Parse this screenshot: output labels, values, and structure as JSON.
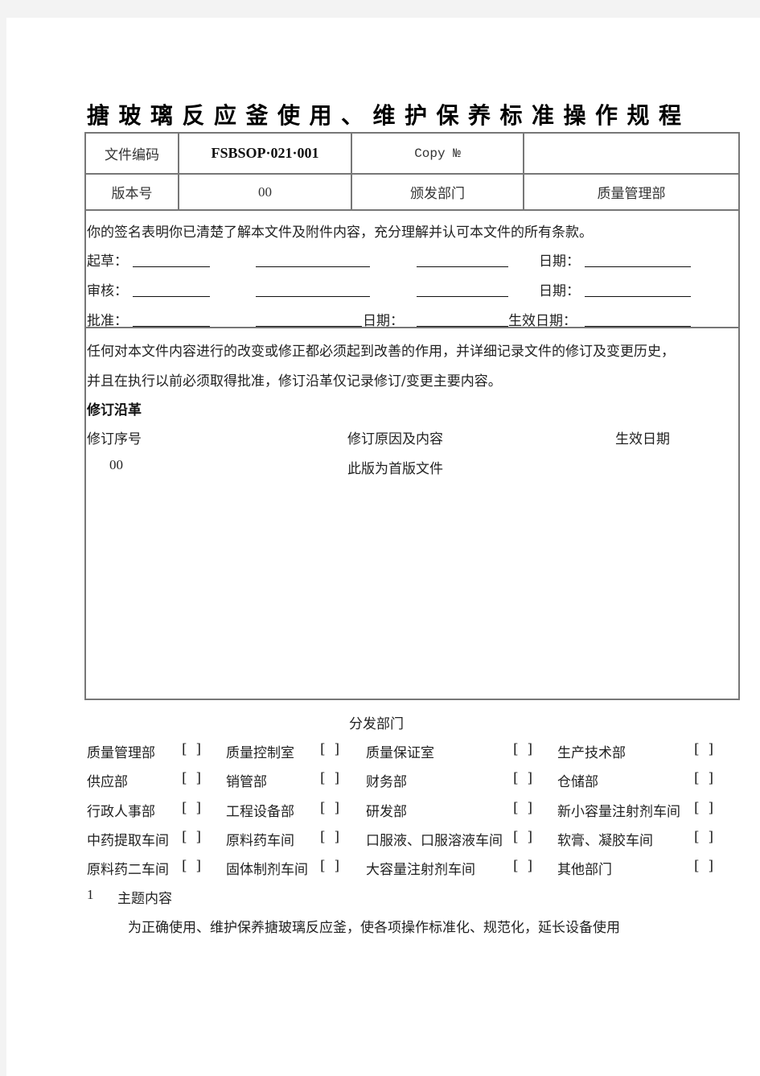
{
  "document": {
    "title": "搪玻璃反应釜使用、维护保养标准操作规程",
    "header_table": {
      "row1": {
        "label1": "文件编码",
        "value1": "FSBSOP·021·001",
        "label2": "Copy №",
        "value2": ""
      },
      "row2": {
        "label1": "版本号",
        "value1": "00",
        "label2": "颁发部门",
        "value2": "质量管理部"
      }
    },
    "signature_section": {
      "statement": "你的签名表明你已清楚了解本文件及附件内容，充分理解并认可本文件的所有条款。",
      "rows": [
        {
          "label": "起草：",
          "date_label": "日期："
        },
        {
          "label": "审核：",
          "date_label": "日期："
        },
        {
          "label": "批准：",
          "mid_label": "日期：",
          "date_label": "生效日期："
        }
      ]
    },
    "revision_section": {
      "statement_line1": "任何对本文件内容进行的改变或修正都必须起到改善的作用，并详细记录文件的修订及变更历史，",
      "statement_line2": "并且在执行以前必须取得批准，修订沿革仅记录修订/变更主要内容。",
      "heading": "修订沿革",
      "columns": [
        "修订序号",
        "修订原因及内容",
        "生效日期"
      ],
      "rows": [
        {
          "number": "00",
          "reason": "此版为首版文件",
          "date": ""
        }
      ]
    },
    "distribution": {
      "heading": "分发部门",
      "checkbox_symbol": "[  ]",
      "rows": [
        [
          "质量管理部",
          "质量控制室",
          "质量保证室",
          "生产技术部"
        ],
        [
          "供应部",
          "销管部",
          "财务部",
          "仓储部"
        ],
        [
          "行政人事部",
          "工程设备部",
          "研发部",
          "新小容量注射剂车间"
        ],
        [
          "中药提取车间",
          "原料药车间",
          "口服液、口服溶液车间",
          "软膏、凝胶车间"
        ],
        [
          "原料药二车间",
          "固体制剂车间",
          "大容量注射剂车间",
          "其他部门"
        ]
      ]
    },
    "section1": {
      "number": "1",
      "heading": "主题内容",
      "body": "为正确使用、维护保养搪玻璃反应釜，使各项操作标准化、规范化，延长设备使用"
    }
  }
}
